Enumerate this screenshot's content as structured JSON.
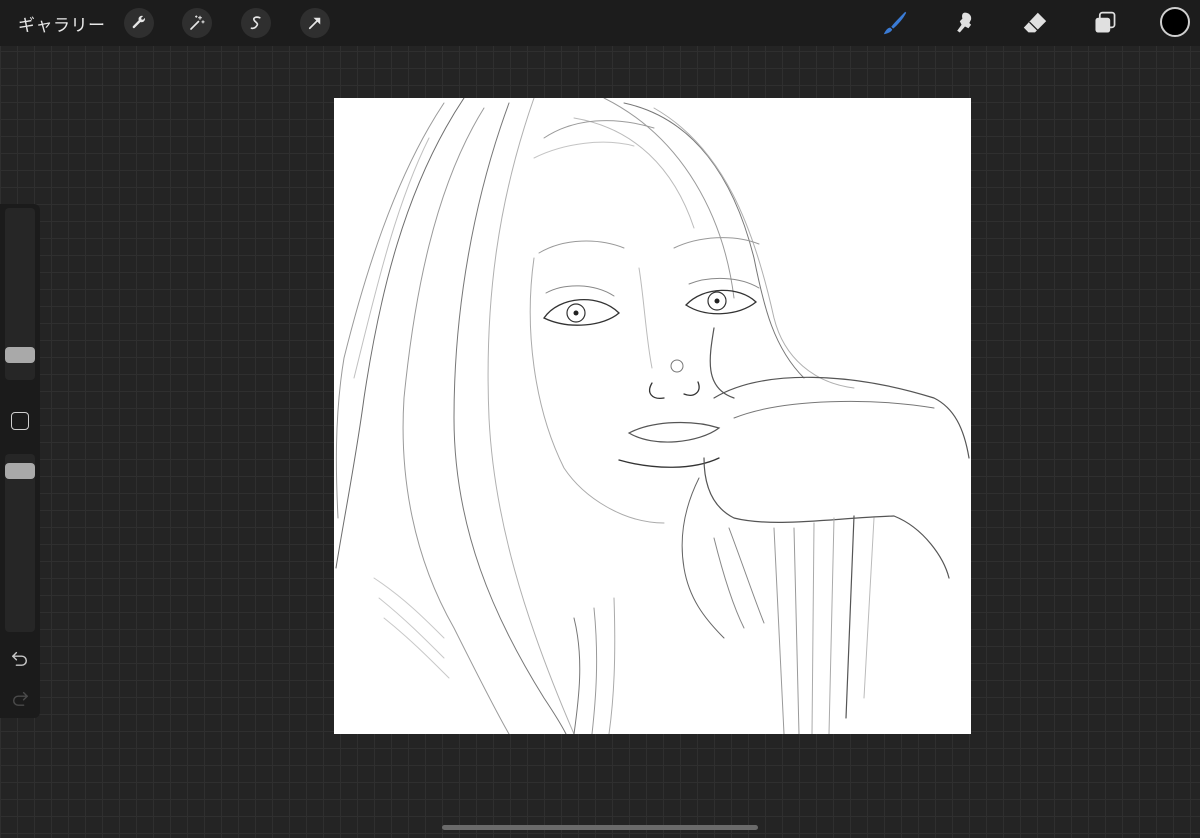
{
  "topbar": {
    "gallery_label": "ギャラリー",
    "left_tools": [
      "wrench-icon",
      "magic-wand-icon",
      "selection-icon",
      "transform-arrow-icon"
    ],
    "right_tools": [
      "brush-icon",
      "smudge-icon",
      "eraser-icon",
      "layers-icon"
    ],
    "active_tool": "brush-icon",
    "active_color": "#3a7bd5",
    "current_color": "#000000"
  },
  "sidebar": {
    "brush_size_level": 0.15,
    "opacity_level": 1.0,
    "controls": [
      "brush-size-slider",
      "modify-button",
      "opacity-slider",
      "undo-icon",
      "redo-icon"
    ]
  },
  "canvas": {
    "background": "#ffffff",
    "content": "sketch-artwork"
  }
}
